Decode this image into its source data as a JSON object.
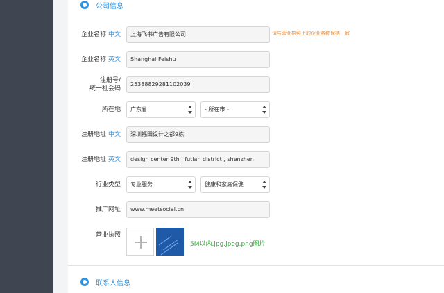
{
  "sections": {
    "company": "公司信息",
    "contact": "联系人信息"
  },
  "fields": {
    "company_name_cn": {
      "label": "企业名称",
      "sub": "中文",
      "value": "上海飞书广告有限公司",
      "hint": "请与营业执照上的企业名称保持一致"
    },
    "company_name_en": {
      "label": "企业名称",
      "sub": "英文",
      "value": "Shanghai Feishu"
    },
    "reg_number": {
      "label_line1": "注册号/",
      "label_line2": "统一社会码",
      "value": "25388829281102039"
    },
    "location": {
      "label": "所在地",
      "province": "广东省",
      "city": "- 所在市 -"
    },
    "address_cn": {
      "label": "注册地址",
      "sub": "中文",
      "value": "深圳福田设计之都9栋"
    },
    "address_en": {
      "label": "注册地址",
      "sub": "英文",
      "value": "design center 9th , futian district , shenzhen"
    },
    "industry": {
      "label": "行业类型",
      "primary": "专业服务",
      "secondary": "健康和家庭保健"
    },
    "website": {
      "label": "推广网址",
      "value": "www.meetsocial.cn"
    },
    "license": {
      "label": "营业执照",
      "hint": "5M以内,jpg,jpeg,png图片"
    }
  },
  "colors": {
    "accent": "#2f94e0",
    "warning": "#f08c2e",
    "success": "#36a53a",
    "sidebar": "#3f4651"
  },
  "icons": [
    "section-dot-icon",
    "select-arrows-icon",
    "plus-icon"
  ]
}
